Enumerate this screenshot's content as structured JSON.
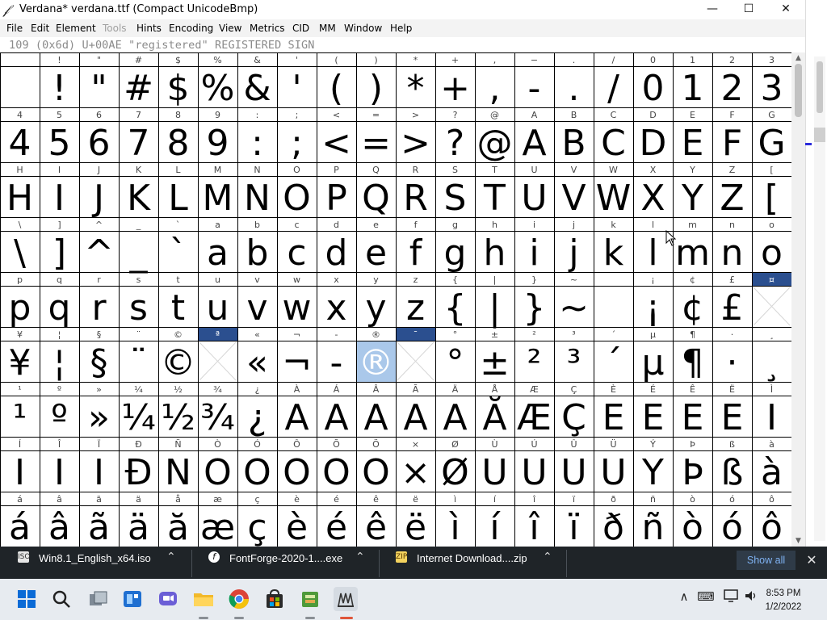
{
  "window": {
    "title": "Verdana* verdana.ttf (Compact UnicodeBmp)",
    "app_icon": "𝒻",
    "controls": {
      "minimize": "—",
      "maximize": "☐",
      "close": "✕"
    }
  },
  "menu": [
    {
      "label": "File",
      "disabled": false
    },
    {
      "label": "Edit",
      "disabled": false
    },
    {
      "label": "Element",
      "disabled": false
    },
    {
      "label": "Tools",
      "disabled": true
    },
    {
      "label": "Hints",
      "disabled": false
    },
    {
      "label": "Encoding",
      "disabled": false
    },
    {
      "label": "View",
      "disabled": false
    },
    {
      "label": "Metrics",
      "disabled": false
    },
    {
      "label": "CID",
      "disabled": false
    },
    {
      "label": "MM",
      "disabled": false
    },
    {
      "label": "Window",
      "disabled": false
    },
    {
      "label": "Help",
      "disabled": false
    }
  ],
  "glyph_info": "109 (0x6d) U+00AE \"registered\" REGISTERED SIGN",
  "grid": {
    "rows": [
      {
        "labels": [
          " ",
          "!",
          "\"",
          "#",
          "$",
          "%",
          "&",
          "'",
          "(",
          ")",
          "*",
          "+",
          ",",
          "−",
          ".",
          "/",
          "0",
          "1",
          "2",
          "3"
        ],
        "glyphs": [
          " ",
          "!",
          "\"",
          "#",
          "$",
          "%",
          "&",
          "'",
          "(",
          ")",
          "*",
          "+",
          ",",
          "-",
          ".",
          "/",
          "0",
          "1",
          "2",
          "3"
        ]
      },
      {
        "labels": [
          "4",
          "5",
          "6",
          "7",
          "8",
          "9",
          ":",
          ";",
          "<",
          "=",
          ">",
          "?",
          "@",
          "A",
          "B",
          "C",
          "D",
          "E",
          "F",
          "G"
        ],
        "glyphs": [
          "4",
          "5",
          "6",
          "7",
          "8",
          "9",
          ":",
          ";",
          "<",
          "=",
          ">",
          "?",
          "@",
          "A",
          "B",
          "C",
          "D",
          "E",
          "F",
          "G"
        ]
      },
      {
        "labels": [
          "H",
          "I",
          "J",
          "K",
          "L",
          "M",
          "N",
          "O",
          "P",
          "Q",
          "R",
          "S",
          "T",
          "U",
          "V",
          "W",
          "X",
          "Y",
          "Z",
          "["
        ],
        "glyphs": [
          "H",
          "I",
          "J",
          "K",
          "L",
          "M",
          "N",
          "O",
          "P",
          "Q",
          "R",
          "S",
          "T",
          "U",
          "V",
          "W",
          "X",
          "Y",
          "Z",
          "["
        ]
      },
      {
        "labels": [
          "\\",
          "]",
          "^",
          "_",
          "`",
          "a",
          "b",
          "c",
          "d",
          "e",
          "f",
          "g",
          "h",
          "i",
          "j",
          "k",
          "l",
          "m",
          "n",
          "o"
        ],
        "glyphs": [
          "\\",
          "]",
          "^",
          "_",
          "`",
          "a",
          "b",
          "c",
          "d",
          "e",
          "f",
          "g",
          "h",
          "i",
          "j",
          "k",
          "l",
          "m",
          "n",
          "o"
        ]
      },
      {
        "labels": [
          "p",
          "q",
          "r",
          "s",
          "t",
          "u",
          "v",
          "w",
          "x",
          "y",
          "z",
          "{",
          "|",
          "}",
          "~",
          "",
          "¡",
          "¢",
          "£",
          "¤"
        ],
        "glyphs": [
          "p",
          "q",
          "r",
          "s",
          "t",
          "u",
          "v",
          "w",
          "x",
          "y",
          "z",
          "{",
          "|",
          "}",
          "~",
          "",
          "¡",
          "¢",
          "£",
          "×"
        ]
      },
      {
        "labels": [
          "¥",
          "¦",
          "§",
          "¨",
          "©",
          "ª",
          "«",
          "¬",
          "-",
          "®",
          "¯",
          "°",
          "±",
          "²",
          "³",
          "´",
          "µ",
          "¶",
          "·",
          "¸"
        ],
        "glyphs": [
          "¥",
          "¦",
          "§",
          "¨",
          "©",
          "×",
          "«",
          "¬",
          "-",
          "®",
          "×",
          "°",
          "±",
          "²",
          "³",
          "´",
          "µ",
          "¶",
          "·",
          "¸"
        ]
      },
      {
        "labels": [
          "¹",
          "º",
          "»",
          "¼",
          "½",
          "¾",
          "¿",
          "À",
          "Á",
          "Â",
          "Ã",
          "Ä",
          "Å",
          "Æ",
          "Ç",
          "È",
          "É",
          "Ê",
          "Ë",
          "Ì"
        ],
        "glyphs": [
          "¹",
          "º",
          "»",
          "¼",
          "½",
          "¾",
          "¿",
          "A",
          "A",
          "A",
          "A",
          "A",
          "Ă",
          "Æ",
          "Ç",
          "E",
          "E",
          "E",
          "E",
          "I"
        ]
      },
      {
        "labels": [
          "Í",
          "Î",
          "Ï",
          "Ð",
          "Ñ",
          "Ò",
          "Ó",
          "Ô",
          "Õ",
          "Ö",
          "×",
          "Ø",
          "Ù",
          "Ú",
          "Û",
          "Ü",
          "Ý",
          "Þ",
          "ß",
          "à"
        ],
        "glyphs": [
          "I",
          "I",
          "I",
          "Đ",
          "N",
          "O",
          "O",
          "O",
          "O",
          "O",
          "×",
          "Ø",
          "U",
          "U",
          "U",
          "U",
          "Y",
          "Þ",
          "ß",
          "à"
        ]
      },
      {
        "labels": [
          "á",
          "â",
          "ã",
          "ä",
          "å",
          "æ",
          "ç",
          "è",
          "é",
          "ê",
          "ë",
          "ì",
          "í",
          "î",
          "ï",
          "ð",
          "ñ",
          "ò",
          "ó",
          "ô"
        ],
        "glyphs": [
          "á",
          "â",
          "ã",
          "ä",
          "ă",
          "æ",
          "ç",
          "è",
          "é",
          "ê",
          "ë",
          "ì",
          "í",
          "î",
          "ï",
          "ð",
          "ñ",
          "ò",
          "ó",
          "ô"
        ]
      }
    ],
    "empty_cells": [
      [
        4,
        19
      ],
      [
        5,
        5
      ],
      [
        5,
        10
      ]
    ],
    "highlighted_label_cells": [
      [
        4,
        19
      ],
      [
        5,
        5
      ],
      [
        5,
        10
      ]
    ],
    "selected_cell": [
      5,
      9
    ],
    "colors": {
      "label_highlight": "#2b4f8f",
      "selected_cell": "#aac8ea",
      "grid_line": "#000000",
      "label_text": "#444444"
    }
  },
  "notifications": {
    "downloads": [
      {
        "label": "Win8.1_English_x64.iso",
        "icon": "iso-file-icon"
      },
      {
        "label": "FontForge-2020-1....exe",
        "icon": "fontforge-icon"
      },
      {
        "label": "Internet Download....zip",
        "icon": "zip-file-icon"
      }
    ],
    "show_all": "Show all",
    "close": "✕"
  },
  "taskbar": {
    "apps": [
      "windows-start-icon",
      "search-icon",
      "task-view-icon",
      "widgets-icon",
      "teams-chat-icon",
      "file-explorer-icon",
      "chrome-icon",
      "microsoft-store-icon",
      "archive-app-icon",
      "fontforge-app-icon"
    ],
    "tray": {
      "chevron": "∧",
      "keyboard": "⌨",
      "network": "🖵",
      "volume": "🔊"
    },
    "time": "8:53 PM",
    "date": "1/2/2022"
  }
}
